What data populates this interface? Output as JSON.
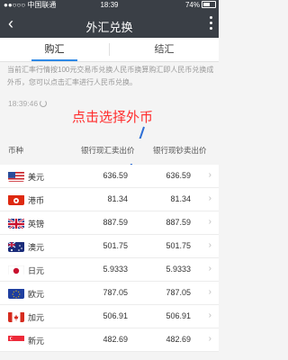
{
  "status_bar": {
    "carrier": "●●○○○ 中国联通",
    "time": "18:39",
    "battery_pct": "74%"
  },
  "nav": {
    "back_glyph": "‹",
    "title": "外汇兑换"
  },
  "tabs": [
    {
      "label": "购汇",
      "active": true
    },
    {
      "label": "结汇",
      "active": false
    }
  ],
  "notice": "当前汇率行情按100元交易币兑换人民币换算购汇即人民币兑换成外币，您可以点击汇率进行人民币兑换。",
  "update_time": "18:39:46",
  "annotation": "点击选择外币",
  "columns": {
    "currency": "币种",
    "col1": "银行现汇卖出价",
    "col2": "银行现钞卖出价"
  },
  "rows": [
    {
      "name": "美元",
      "flag": "flag-us",
      "spot_sell": "636.59",
      "cash_sell": "636.59"
    },
    {
      "name": "港币",
      "flag": "flag-hk",
      "spot_sell": "81.34",
      "cash_sell": "81.34"
    },
    {
      "name": "英镑",
      "flag": "flag-gb",
      "spot_sell": "887.59",
      "cash_sell": "887.59"
    },
    {
      "name": "澳元",
      "flag": "flag-au",
      "spot_sell": "501.75",
      "cash_sell": "501.75"
    },
    {
      "name": "日元",
      "flag": "flag-jp",
      "spot_sell": "5.9333",
      "cash_sell": "5.9333"
    },
    {
      "name": "欧元",
      "flag": "flag-eu",
      "spot_sell": "787.05",
      "cash_sell": "787.05"
    },
    {
      "name": "加元",
      "flag": "flag-ca",
      "spot_sell": "506.91",
      "cash_sell": "506.91"
    },
    {
      "name": "新元",
      "flag": "flag-sg",
      "spot_sell": "482.69",
      "cash_sell": "482.69"
    }
  ],
  "colors": {
    "nav_bg": "#3a3f46",
    "accent": "#2e89e6",
    "annotation": "#ff2d2d"
  }
}
